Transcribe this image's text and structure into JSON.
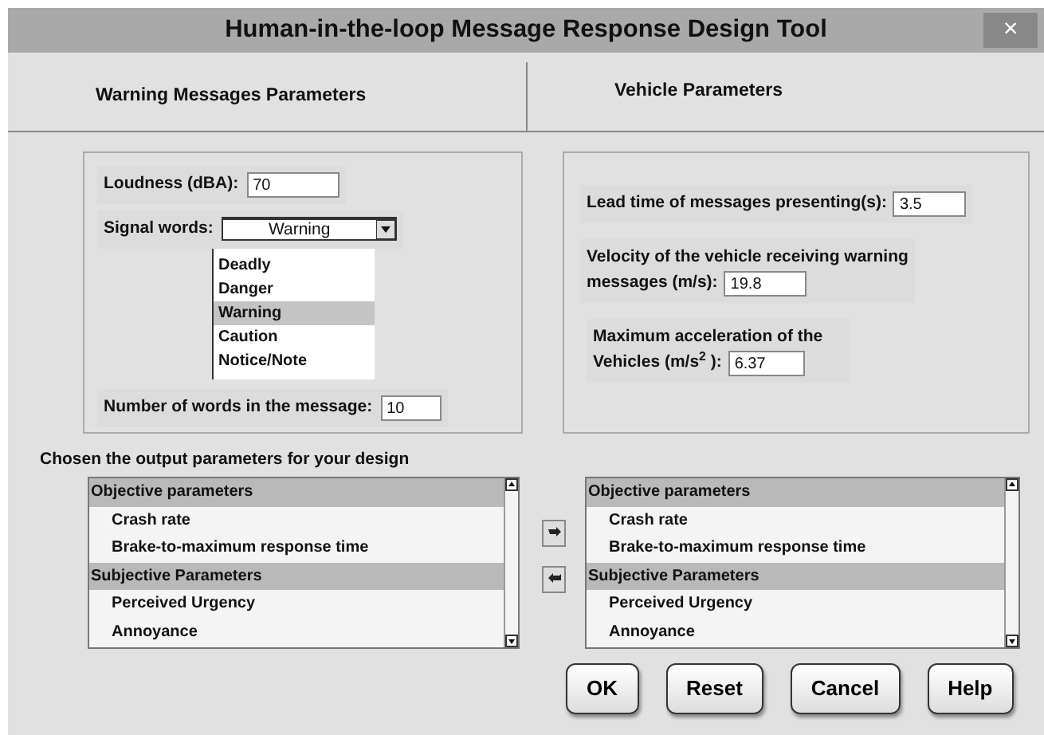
{
  "window": {
    "title": "Human-in-the-loop Message Response Design Tool",
    "close": "×"
  },
  "headers": [
    "Warning Messages Parameters",
    "Vehicle Parameters"
  ],
  "warning_params": {
    "loudness": {
      "label": "Loudness (dBA):",
      "value": "70"
    },
    "signal_words": {
      "label": "Signal words:",
      "value": "Warning",
      "options": [
        {
          "label": "Deadly",
          "selected": false
        },
        {
          "label": "Danger",
          "selected": false
        },
        {
          "label": "Warning",
          "selected": true
        },
        {
          "label": "Caution",
          "selected": false
        },
        {
          "label": "Notice/Note",
          "selected": false
        }
      ]
    },
    "word_count": {
      "label": "Number of words in the message:",
      "value": "10"
    }
  },
  "vehicle_params": [
    {
      "label_lines": [
        "Lead time of messages presenting(s):"
      ],
      "value": "3.5"
    },
    {
      "label_lines": [
        "Velocity of the vehicle receiving warning",
        "messages  (m/s):"
      ],
      "value": "19.8"
    },
    {
      "label_lines": [
        "Maximum acceleration of the",
        "Vehicles (m/s$^{2}$ ):"
      ],
      "value": "6.37"
    }
  ],
  "output": {
    "heading": "Chosen the output parameters for your design",
    "lists": [
      {
        "items": [
          {
            "label": "Objective parameters",
            "kind": "group"
          },
          {
            "label": "Crash rate",
            "kind": "item"
          },
          {
            "label": "Brake-to-maximum response time",
            "kind": "item"
          },
          {
            "label": "Subjective Parameters",
            "kind": "group"
          },
          {
            "label": "Perceived Urgency",
            "kind": "item"
          },
          {
            "label": "Annoyance",
            "kind": "item"
          }
        ]
      },
      {
        "items": [
          {
            "label": "Objective parameters",
            "kind": "group"
          },
          {
            "label": "Crash rate",
            "kind": "item"
          },
          {
            "label": "Brake-to-maximum response time",
            "kind": "item"
          },
          {
            "label": "Subjective Parameters",
            "kind": "group"
          },
          {
            "label": "Perceived Urgency",
            "kind": "item"
          },
          {
            "label": "Annoyance",
            "kind": "item"
          }
        ]
      }
    ]
  },
  "buttons": [
    "OK",
    "Reset",
    "Cancel",
    "Help"
  ]
}
